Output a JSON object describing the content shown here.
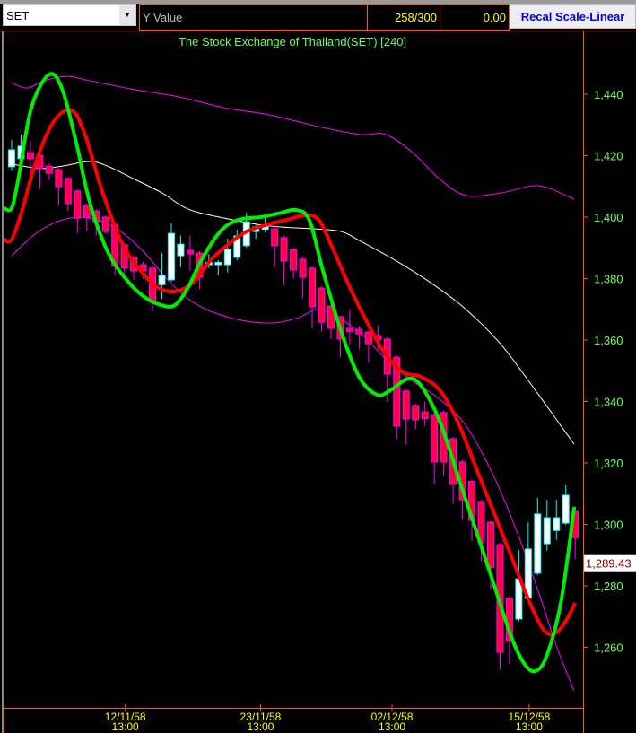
{
  "toolbar": {
    "symbol": "SET",
    "y_value_label": "Y Value",
    "count": "258/300",
    "value": "0.00",
    "recal_button": "Recal Scale-Linear"
  },
  "colors": {
    "up_fill": "#ffffff",
    "up_line": "#00ffff",
    "down_fill": "#ff0040",
    "down_line": "#ff00ff",
    "fast_ma": "#00ee00",
    "slow_ma": "#ff0000",
    "mid_band": "#ffffcc",
    "band": "#ff00ff",
    "axis": "#ff5a00",
    "tick_text": "#66ff66",
    "date_text": "#ffff00"
  },
  "chart_data": {
    "type": "candlestick",
    "title": "The Stock Exchange of Thailand(SET) [240]",
    "ylim": [
      1240,
      1460
    ],
    "xlim": [
      -0.8,
      60.8
    ],
    "y_ticks": [
      1440,
      1420,
      1400,
      1380,
      1360,
      1340,
      1320,
      1300,
      1280,
      1260
    ],
    "y_tick_labels": [
      "1,440",
      "1,420",
      "1,400",
      "1,380",
      "1,360",
      "1,340",
      "1,320",
      "1,300",
      "1,280",
      "1,260"
    ],
    "last_price": 1289.43,
    "last_price_label": "1,289.43",
    "x_ticks": [
      {
        "index": 12.1,
        "date": "12/11/58",
        "time": "13:00"
      },
      {
        "index": 26.5,
        "date": "23/11/58",
        "time": "13:00"
      },
      {
        "index": 40.5,
        "date": "02/12/58",
        "time": "13:00"
      },
      {
        "index": 55.1,
        "date": "15/12/58",
        "time": "13:00"
      }
    ],
    "candles_ohlc": [
      [
        1416.4,
        1425.1,
        1415.0,
        1421.9
      ],
      [
        1419.0,
        1426.9,
        1415.0,
        1423.1
      ],
      [
        1421.0,
        1424.8,
        1413.4,
        1419.0
      ],
      [
        1420.1,
        1420.5,
        1409.3,
        1415.8
      ],
      [
        1416.6,
        1417.5,
        1412.0,
        1414.3
      ],
      [
        1415.5,
        1416.0,
        1404.0,
        1409.9
      ],
      [
        1412.6,
        1413.0,
        1402.0,
        1404.4
      ],
      [
        1408.5,
        1409.0,
        1394.7,
        1399.7
      ],
      [
        1403.8,
        1404.5,
        1395.6,
        1400.0
      ],
      [
        1402.0,
        1402.5,
        1394.0,
        1398.5
      ],
      [
        1400.0,
        1400.5,
        1394.7,
        1395.3
      ],
      [
        1397.7,
        1398.2,
        1381.0,
        1384.0
      ],
      [
        1391.0,
        1391.5,
        1380.0,
        1383.4
      ],
      [
        1386.9,
        1387.5,
        1379.6,
        1382.5
      ],
      [
        1384.5,
        1385.5,
        1380.0,
        1382.5
      ],
      [
        1383.4,
        1384.0,
        1369.3,
        1372.3
      ],
      [
        1378.0,
        1388.3,
        1373.4,
        1381.0
      ],
      [
        1379.6,
        1398.0,
        1379.0,
        1394.7
      ],
      [
        1387.4,
        1394.0,
        1383.7,
        1391.2
      ],
      [
        1389.2,
        1394.0,
        1382.5,
        1388.0
      ],
      [
        1388.3,
        1389.0,
        1376.6,
        1380.4
      ],
      [
        1384.5,
        1388.0,
        1383.4,
        1385.2
      ],
      [
        1384.5,
        1386.0,
        1381.0,
        1385.3
      ],
      [
        1384.5,
        1393.0,
        1382.0,
        1389.5
      ],
      [
        1386.9,
        1396.0,
        1386.0,
        1393.9
      ],
      [
        1390.7,
        1401.5,
        1390.0,
        1398.5
      ],
      [
        1395.3,
        1398.0,
        1393.0,
        1396.8
      ],
      [
        1396.0,
        1400.0,
        1395.0,
        1397.5
      ],
      [
        1396.2,
        1397.0,
        1383.6,
        1390.7
      ],
      [
        1393.3,
        1394.0,
        1378.0,
        1385.7
      ],
      [
        1389.5,
        1390.0,
        1380.0,
        1382.8
      ],
      [
        1386.3,
        1387.0,
        1373.7,
        1380.4
      ],
      [
        1383.4,
        1384.0,
        1363.8,
        1370.8
      ],
      [
        1376.9,
        1377.5,
        1362.8,
        1365.8
      ],
      [
        1371.1,
        1371.6,
        1360.3,
        1363.8
      ],
      [
        1367.6,
        1368.0,
        1354.4,
        1360.3
      ],
      [
        1363.8,
        1370.0,
        1358.7,
        1362.8
      ],
      [
        1363.5,
        1364.6,
        1357.0,
        1362.0
      ],
      [
        1362.6,
        1363.0,
        1352.8,
        1358.8
      ],
      [
        1361.5,
        1364.6,
        1357.0,
        1360.0
      ],
      [
        1360.3,
        1361.0,
        1339.9,
        1348.9
      ],
      [
        1354.4,
        1355.0,
        1327.9,
        1332.0
      ],
      [
        1343.4,
        1344.0,
        1326.0,
        1334.3
      ],
      [
        1338.7,
        1339.2,
        1331.0,
        1334.0
      ],
      [
        1336.6,
        1340.0,
        1332.0,
        1334.5
      ],
      [
        1335.5,
        1336.0,
        1313.0,
        1320.3
      ],
      [
        1336.4,
        1337.0,
        1315.9,
        1320.3
      ],
      [
        1327.9,
        1328.5,
        1306.6,
        1313.0
      ],
      [
        1320.3,
        1321.0,
        1301.6,
        1308.0
      ],
      [
        1314.0,
        1314.5,
        1294.6,
        1301.3
      ],
      [
        1307.4,
        1308.0,
        1288.0,
        1294.0
      ],
      [
        1300.7,
        1301.2,
        1278.8,
        1286.0
      ],
      [
        1293.4,
        1294.0,
        1252.8,
        1258.4
      ],
      [
        1276.0,
        1276.5,
        1254.6,
        1262.0
      ],
      [
        1269.2,
        1291.7,
        1268.5,
        1282.3
      ],
      [
        1276.0,
        1300.7,
        1275.0,
        1292.0
      ],
      [
        1284.1,
        1308.6,
        1283.5,
        1303.4
      ],
      [
        1293.7,
        1308.0,
        1291.5,
        1302.2
      ],
      [
        1298.0,
        1308.0,
        1295.0,
        1302.2
      ],
      [
        1300.4,
        1312.7,
        1299.8,
        1309.5
      ],
      [
        1304.2,
        1305.0,
        1288.8,
        1295.7
      ]
    ],
    "series": [
      {
        "name": "fast_ma",
        "points": [
          [
            -0.8,
            1402.9
          ],
          [
            0,
            1402.9
          ],
          [
            0.7,
            1412.3
          ],
          [
            2.1,
            1435.6
          ],
          [
            4,
            1446.4
          ],
          [
            5.4,
            1441.5
          ],
          [
            6.9,
            1423.9
          ],
          [
            8.3,
            1405
          ],
          [
            10.2,
            1388.9
          ],
          [
            12.1,
            1380.1
          ],
          [
            14,
            1374.3
          ],
          [
            15.9,
            1371.4
          ],
          [
            17.4,
            1371.4
          ],
          [
            18.8,
            1377.2
          ],
          [
            20.2,
            1386
          ],
          [
            22.2,
            1395.3
          ],
          [
            24.1,
            1399.1
          ],
          [
            26.5,
            1400
          ],
          [
            28.4,
            1401.2
          ],
          [
            30.3,
            1402.3
          ],
          [
            31.7,
            1399
          ],
          [
            33.1,
            1383.1
          ],
          [
            35.1,
            1362.6
          ],
          [
            37,
            1348
          ],
          [
            38.9,
            1342.2
          ],
          [
            40.3,
            1343.6
          ],
          [
            42.2,
            1347.4
          ],
          [
            43.6,
            1345.1
          ],
          [
            45.6,
            1333.4
          ],
          [
            47.5,
            1315.9
          ],
          [
            49.4,
            1298.4
          ],
          [
            51.3,
            1280.9
          ],
          [
            53.2,
            1263.4
          ],
          [
            54.6,
            1254.6
          ],
          [
            55.8,
            1252.3
          ],
          [
            57,
            1257.5
          ],
          [
            58.5,
            1275
          ],
          [
            59.9,
            1305.7
          ]
        ]
      },
      {
        "name": "slow_ma",
        "points": [
          [
            -0.8,
            1392.7
          ],
          [
            0,
            1392.7
          ],
          [
            1.1,
            1402
          ],
          [
            2.6,
            1418.1
          ],
          [
            4.5,
            1431.2
          ],
          [
            6.4,
            1434.7
          ],
          [
            7.8,
            1426.9
          ],
          [
            9.7,
            1407.9
          ],
          [
            11.7,
            1391.8
          ],
          [
            13.6,
            1383.1
          ],
          [
            15.5,
            1377.2
          ],
          [
            17.4,
            1375.8
          ],
          [
            19.3,
            1378.7
          ],
          [
            21.2,
            1386
          ],
          [
            23.1,
            1391.2
          ],
          [
            25,
            1395.3
          ],
          [
            27.4,
            1397.7
          ],
          [
            29.3,
            1399.1
          ],
          [
            31.2,
            1400.6
          ],
          [
            32.7,
            1399.1
          ],
          [
            34.1,
            1390.4
          ],
          [
            36,
            1377.2
          ],
          [
            37.9,
            1365.5
          ],
          [
            39.8,
            1355.3
          ],
          [
            41.7,
            1349.5
          ],
          [
            43.6,
            1348
          ],
          [
            45.6,
            1343.6
          ],
          [
            47.5,
            1333.4
          ],
          [
            49.4,
            1318.8
          ],
          [
            51.3,
            1304.2
          ],
          [
            53.2,
            1289.6
          ],
          [
            55.1,
            1275
          ],
          [
            56.5,
            1266.3
          ],
          [
            57.5,
            1264.2
          ],
          [
            58.5,
            1266.3
          ],
          [
            59.4,
            1270.7
          ],
          [
            60,
            1274.5
          ]
        ]
      },
      {
        "name": "mid_band",
        "points": [
          [
            0.2,
            1417.2
          ],
          [
            3.1,
            1415.8
          ],
          [
            5.4,
            1416.6
          ],
          [
            8.3,
            1418.1
          ],
          [
            10.2,
            1416.6
          ],
          [
            13.1,
            1412.3
          ],
          [
            16,
            1407.9
          ],
          [
            18.8,
            1402.6
          ],
          [
            22.6,
            1399.7
          ],
          [
            27.4,
            1397.1
          ],
          [
            32.2,
            1396.2
          ],
          [
            35.1,
            1395.3
          ],
          [
            37,
            1392.4
          ],
          [
            40.8,
            1386
          ],
          [
            44.6,
            1378.7
          ],
          [
            48.4,
            1369.9
          ],
          [
            52.2,
            1358.2
          ],
          [
            56.1,
            1342.2
          ],
          [
            58.5,
            1332
          ],
          [
            59.9,
            1326.1
          ]
        ]
      },
      {
        "name": "upper_band",
        "points": [
          [
            0,
            1443.8
          ],
          [
            1.6,
            1442
          ],
          [
            3.5,
            1444.4
          ],
          [
            5.9,
            1445.8
          ],
          [
            8.3,
            1444.4
          ],
          [
            13.1,
            1441.5
          ],
          [
            17.9,
            1439.1
          ],
          [
            22.6,
            1435.6
          ],
          [
            27.4,
            1433.3
          ],
          [
            32.2,
            1429.8
          ],
          [
            37,
            1426.9
          ],
          [
            39.8,
            1426.9
          ],
          [
            42.7,
            1421
          ],
          [
            45.6,
            1412.3
          ],
          [
            48.4,
            1407
          ],
          [
            52.2,
            1407.9
          ],
          [
            56.1,
            1410.2
          ],
          [
            59.9,
            1405.8
          ]
        ]
      },
      {
        "name": "lower_band",
        "points": [
          [
            0,
            1387.4
          ],
          [
            2.6,
            1394.7
          ],
          [
            5.4,
            1399.1
          ],
          [
            8.3,
            1399.7
          ],
          [
            11.2,
            1396.2
          ],
          [
            14,
            1388.9
          ],
          [
            16.9,
            1378.7
          ],
          [
            19.8,
            1371.4
          ],
          [
            23.6,
            1367
          ],
          [
            27.4,
            1365.5
          ],
          [
            30.3,
            1367
          ],
          [
            33.1,
            1369.9
          ],
          [
            37,
            1362.6
          ],
          [
            39.8,
            1353.9
          ],
          [
            42.7,
            1346.6
          ],
          [
            45.6,
            1340.7
          ],
          [
            48.4,
            1332
          ],
          [
            51.3,
            1315.9
          ],
          [
            53.7,
            1298.4
          ],
          [
            56.1,
            1278
          ],
          [
            58,
            1260.4
          ],
          [
            59.9,
            1245.8
          ]
        ]
      }
    ]
  }
}
